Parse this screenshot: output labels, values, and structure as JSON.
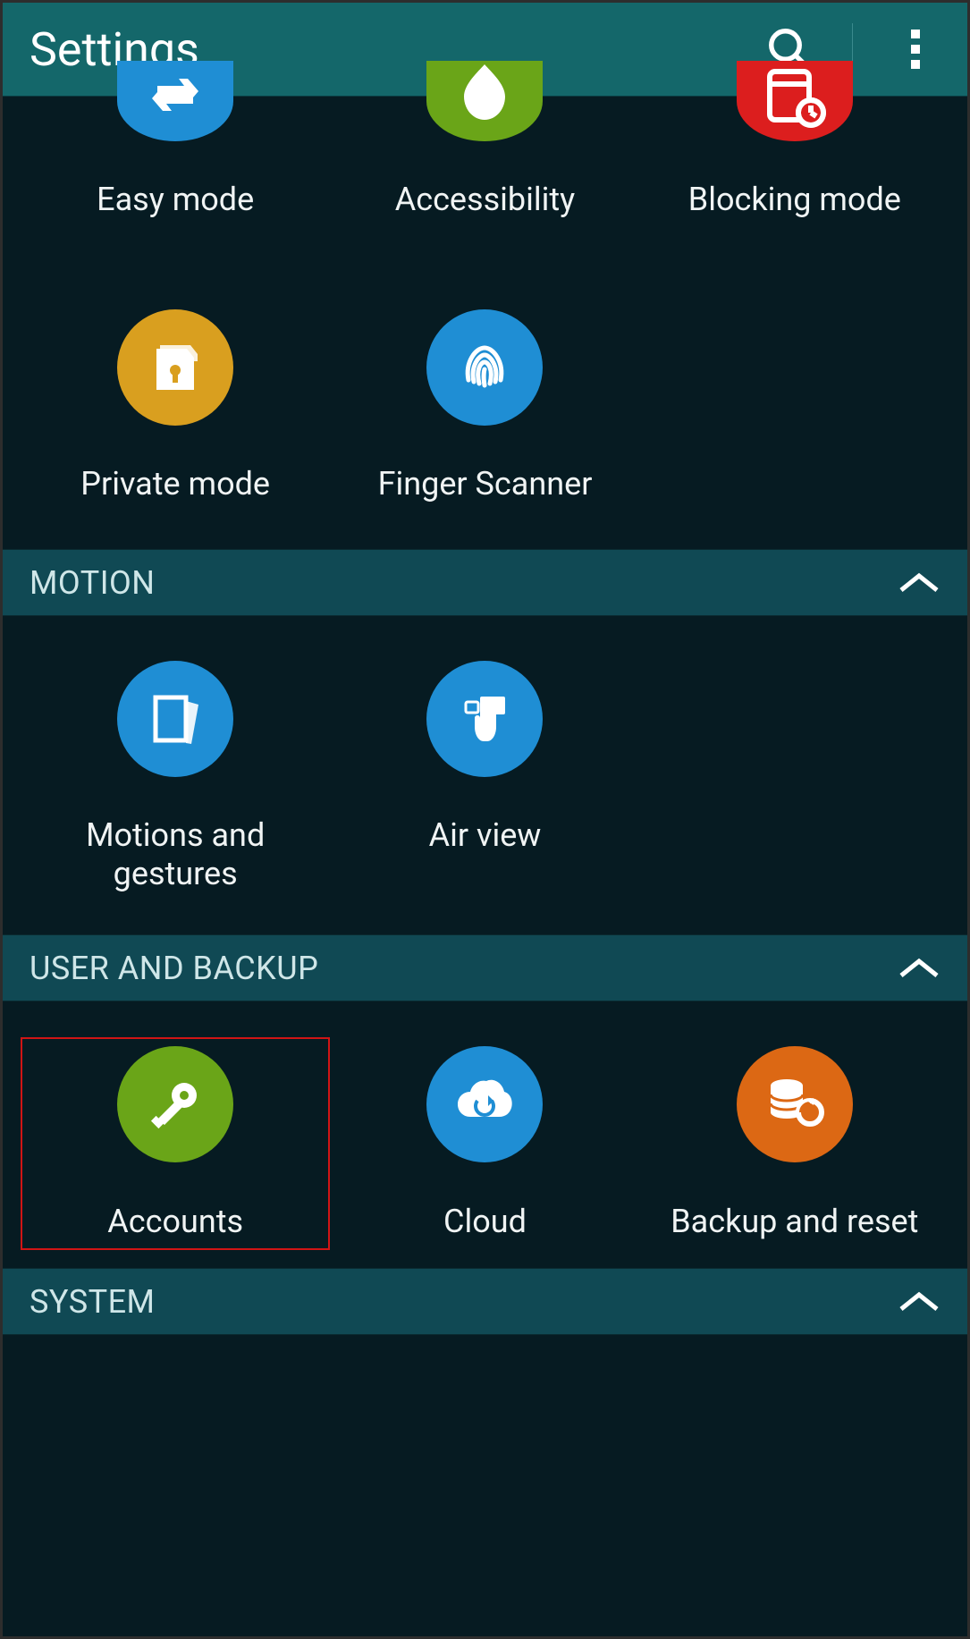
{
  "header": {
    "title": "Settings"
  },
  "sections": {
    "motion": {
      "title": "MOTION"
    },
    "user_backup": {
      "title": "USER AND BACKUP"
    },
    "system": {
      "title": "SYSTEM"
    }
  },
  "items": {
    "easy_mode": {
      "label": "Easy mode"
    },
    "accessibility": {
      "label": "Accessibility"
    },
    "blocking_mode": {
      "label": "Blocking mode"
    },
    "private_mode": {
      "label": "Private mode"
    },
    "finger_scanner": {
      "label": "Finger Scanner"
    },
    "motions_gestures": {
      "label": "Motions and gestures"
    },
    "air_view": {
      "label": "Air view"
    },
    "accounts": {
      "label": "Accounts"
    },
    "cloud": {
      "label": "Cloud"
    },
    "backup_reset": {
      "label": "Backup and reset"
    }
  },
  "colors": {
    "blue": "#1f8ed4",
    "green": "#6aa518",
    "red": "#dc1e1e",
    "yellow": "#d99f1f",
    "orange": "#dc6814"
  }
}
